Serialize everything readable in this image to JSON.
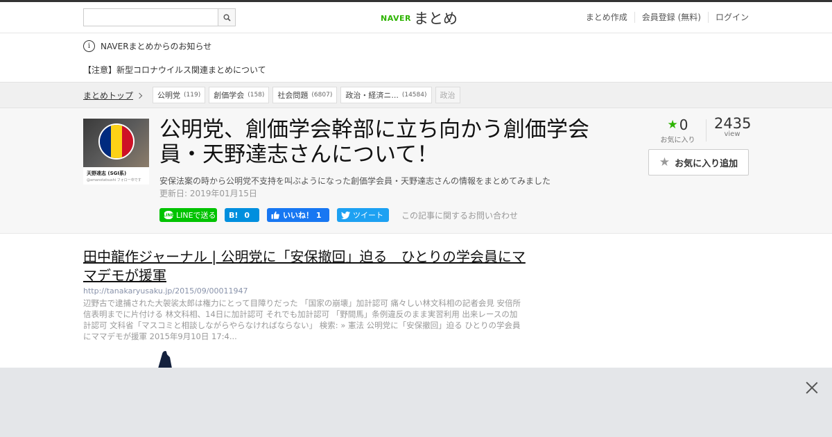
{
  "header": {
    "search_placeholder": "",
    "logo_brand": "NAVER",
    "logo_text": "まとめ",
    "nav": [
      "まとめ作成",
      "会員登録 (無料)",
      "ログイン"
    ]
  },
  "notice": {
    "title": "NAVERまとめからのお知らせ",
    "link": "【注意】新型コロナウイルス関連まとめについて"
  },
  "breadcrumb": {
    "home": "まとめトップ",
    "tags": [
      {
        "label": "公明党",
        "count": "(119)"
      },
      {
        "label": "創価学会",
        "count": "(158)"
      },
      {
        "label": "社会問題",
        "count": "(6807)"
      },
      {
        "label": "政治・経済ニ...",
        "count": "(14584)"
      },
      {
        "label": "政治",
        "count": ""
      }
    ]
  },
  "matome": {
    "thumb_name": "天野達志 (SGI系)",
    "thumb_sub": "@amanotatsushi フォロー中です",
    "title": "公明党、創価学会幹部に立ち向かう創価学会員・天野達志さんについて！",
    "description": "安保法案の時から公明党不支持を叫ぶようになった創価学会員・天野達志さんの情報をまとめてみました",
    "updated": "更新日: 2019年01月15日",
    "share": {
      "line": "LINEで送る",
      "hatena_mark": "B!",
      "hatena_count": "0",
      "fb": "いいね！ 1",
      "tw": "ツイート",
      "contact": "この記事に関するお問い合わせ"
    },
    "favorites": "0",
    "favorites_label": "お気に入り",
    "views": "2435",
    "views_label": "view",
    "fav_button": "お気に入り追加"
  },
  "article": {
    "title": "田中龍作ジャーナル | 公明党に「安保撤回」迫る　ひとりの学会員にママデモが援軍",
    "url": "http://tanakaryusaku.jp/2015/09/00011947",
    "excerpt": "辺野古で逮捕された大袈裟太郎は権力にとって目障りだった 「国家の崩壊」加計認可 痛々しい林文科相の記者会見 安倍所信表明までに片付ける 林文科相、14日に加計認可 それでも加計認可 「野間馬」条例違反のまま実習利用 出来レースの加計認可 文科省「マスコミと相談しながらやらなければならない」 検索: » 憲法 公明党に「安保撤回」迫る ひとりの学会員にママデモが援軍 2015年9月10日 17:4..."
  },
  "colors": {
    "brand_green": "#2db400",
    "line_green": "#00c300",
    "hatena_blue": "#008fde",
    "fb_blue": "#1877f2",
    "tw_blue": "#1da1f2"
  }
}
